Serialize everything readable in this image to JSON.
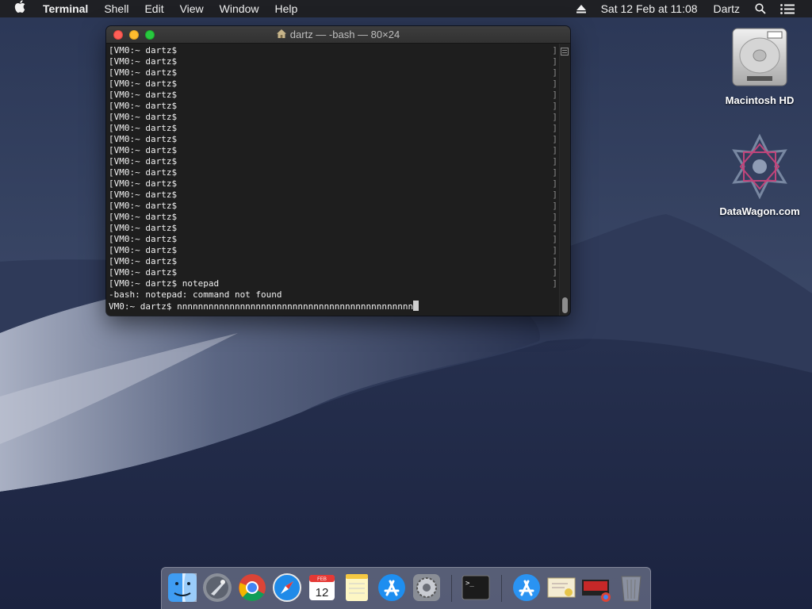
{
  "menubar": {
    "app_name": "Terminal",
    "menus": [
      "Shell",
      "Edit",
      "View",
      "Window",
      "Help"
    ],
    "datetime": "Sat 12 Feb at 11:08",
    "user": "Dartz"
  },
  "terminal": {
    "title": "dartz — -bash — 80×24",
    "lines": [
      "[VM0:~ dartz$",
      "[VM0:~ dartz$",
      "[VM0:~ dartz$",
      "[VM0:~ dartz$",
      "[VM0:~ dartz$",
      "[VM0:~ dartz$",
      "[VM0:~ dartz$",
      "[VM0:~ dartz$",
      "[VM0:~ dartz$",
      "[VM0:~ dartz$",
      "[VM0:~ dartz$",
      "[VM0:~ dartz$",
      "[VM0:~ dartz$",
      "[VM0:~ dartz$",
      "[VM0:~ dartz$",
      "[VM0:~ dartz$",
      "[VM0:~ dartz$",
      "[VM0:~ dartz$",
      "[VM0:~ dartz$",
      "[VM0:~ dartz$",
      "[VM0:~ dartz$",
      "[VM0:~ dartz$ notepad",
      "-bash: notepad: command not found"
    ],
    "prompt_line": "VM0:~ dartz$ nnnnnnnnnnnnnnnnnnnnnnnnnnnnnnnnnnnnnnnnnnnnn"
  },
  "desktop_icons": [
    {
      "label": "Macintosh HD",
      "icon": "hard-drive-icon"
    },
    {
      "label": "DataWagon.com",
      "icon": "datawagon-icon"
    }
  ],
  "dock": {
    "items": [
      {
        "name": "finder",
        "icon": "finder-icon",
        "running": true
      },
      {
        "name": "launchpad",
        "icon": "launchpad-icon",
        "running": false
      },
      {
        "name": "chrome",
        "icon": "chrome-icon",
        "running": false
      },
      {
        "name": "safari",
        "icon": "safari-icon",
        "running": false
      },
      {
        "name": "calendar",
        "icon": "calendar-icon",
        "running": false,
        "badge": "12",
        "month": "FEB"
      },
      {
        "name": "notes",
        "icon": "notes-icon",
        "running": false
      },
      {
        "name": "app-store",
        "icon": "app-store-icon",
        "running": false
      },
      {
        "name": "system-preferences",
        "icon": "gear-icon",
        "running": false
      },
      {
        "name": "terminal",
        "icon": "terminal-icon",
        "running": true
      },
      {
        "name": "app-store-download",
        "icon": "app-store-icon",
        "running": false
      },
      {
        "name": "certificate",
        "icon": "certificate-icon",
        "running": false
      },
      {
        "name": "chrome-app",
        "icon": "chrome-app-icon",
        "running": false
      },
      {
        "name": "trash",
        "icon": "trash-icon",
        "running": false
      }
    ]
  },
  "colors": {
    "terminal_bg": "#1e1e1e",
    "terminal_text": "#f0f0f0",
    "close": "#fe5f57",
    "minimize": "#febc2e",
    "maximize": "#28c840"
  }
}
